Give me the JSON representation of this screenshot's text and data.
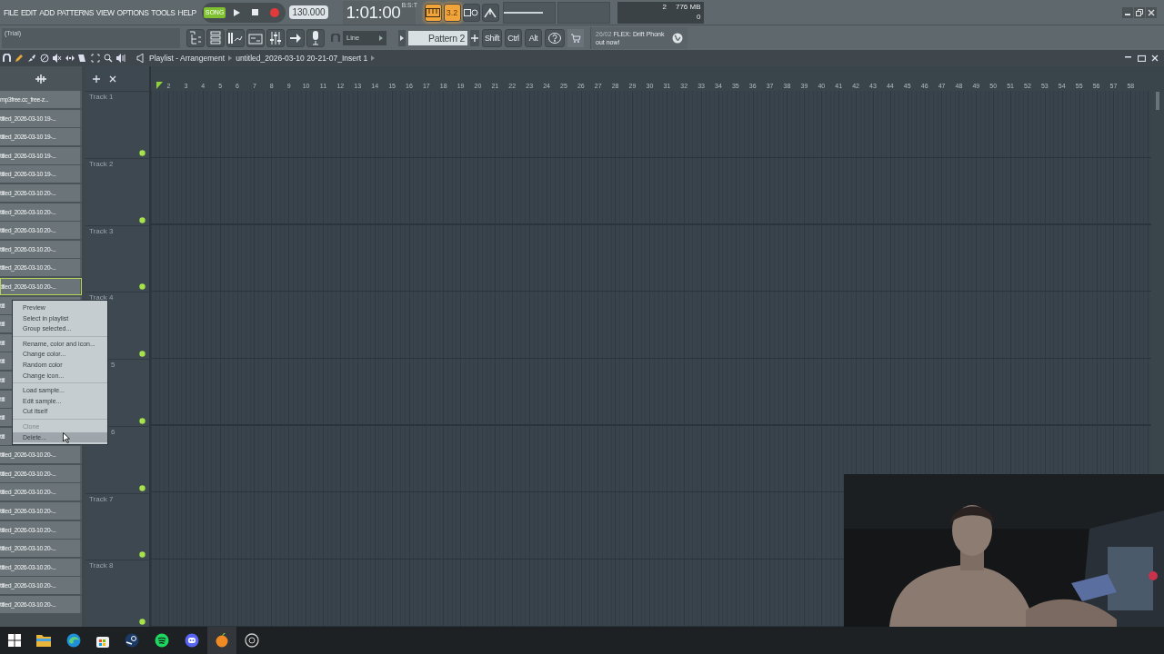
{
  "menu_bar": [
    "FILE",
    "EDIT",
    "ADD",
    "PATTERNS",
    "VIEW",
    "OPTIONS",
    "TOOLS",
    "HELP"
  ],
  "transport": {
    "mode": "SONG",
    "playing": false,
    "recording": true,
    "tempo": "130.000",
    "time": "1:01:00",
    "time_unit": "B:S:T"
  },
  "toggles": [
    {
      "kind": "keyboard",
      "on": true
    },
    {
      "kind": "countdown",
      "label": "3.2",
      "on": true
    },
    {
      "kind": "loop",
      "on": false
    },
    {
      "kind": "metronome",
      "on": false
    }
  ],
  "master_volume": {
    "level": 0.78
  },
  "hint_bar": "(Trial)",
  "snap": "Line",
  "pattern": "Pattern 2",
  "keys": [
    "Shift",
    "Ctrl",
    "Alt"
  ],
  "monitor": {
    "voices": "2",
    "memory": "776 MB",
    "polyphony": "0"
  },
  "news": {
    "date": "26/02",
    "headline": "FLEX: Drift Phonk",
    "subline": "out now!"
  },
  "playlist": {
    "title": "Playlist - Arrangement",
    "breadcrumb": "untitled_2026-03-10 20-21-07_Insert 1"
  },
  "clips": [
    {
      "name": "mp3free.cc_free-z...",
      "selected": false
    },
    {
      "name": "titled_2026-03-10 19-...",
      "selected": false
    },
    {
      "name": "titled_2026-03-10 19-...",
      "selected": false
    },
    {
      "name": "titled_2026-03-10 19-...",
      "selected": false
    },
    {
      "name": "titled_2026-03-10 19-...",
      "selected": false
    },
    {
      "name": "titled_2026-03-10 20-...",
      "selected": false
    },
    {
      "name": "titled_2026-03-10 20-...",
      "selected": false
    },
    {
      "name": "titled_2026-03-10 20-...",
      "selected": false
    },
    {
      "name": "titled_2026-03-10 20-...",
      "selected": false
    },
    {
      "name": "titled_2026-03-10 20-...",
      "selected": false
    },
    {
      "name": "titled_2026-03-10 20-...",
      "selected": true
    },
    {
      "name": "titl",
      "selected": false
    },
    {
      "name": "titl",
      "selected": false
    },
    {
      "name": "titl",
      "selected": false
    },
    {
      "name": "titl",
      "selected": false
    },
    {
      "name": "titl",
      "selected": false
    },
    {
      "name": "titl",
      "selected": false
    },
    {
      "name": "titl",
      "selected": false
    },
    {
      "name": "titl",
      "selected": false
    },
    {
      "name": "titled_2026-03-10 20-...",
      "selected": false
    },
    {
      "name": "titled_2026-03-10 20-...",
      "selected": false
    },
    {
      "name": "titled_2026-03-10 20-...",
      "selected": false
    },
    {
      "name": "titled_2026-03-10 20-...",
      "selected": false
    },
    {
      "name": "titled_2026-03-10 20-...",
      "selected": false
    },
    {
      "name": "titled_2026-03-10 20-...",
      "selected": false
    },
    {
      "name": "titled_2026-03-10 20-...",
      "selected": false
    },
    {
      "name": "titled_2026-03-10 20-...",
      "selected": false
    },
    {
      "name": "titled_2026-03-10 20-...",
      "selected": false
    }
  ],
  "tracks": [
    {
      "name": "Track 1",
      "cut": false
    },
    {
      "name": "Track 2",
      "cut": false
    },
    {
      "name": "Track 3",
      "cut": false
    },
    {
      "name": "Track 4",
      "cut": false
    },
    {
      "name": "5",
      "cut": true
    },
    {
      "name": "6",
      "cut": true
    },
    {
      "name": "Track 7",
      "cut": false
    },
    {
      "name": "Track 8",
      "cut": false
    }
  ],
  "ruler": [
    "2",
    "3",
    "4",
    "5",
    "6",
    "7",
    "8",
    "9",
    "10",
    "11",
    "12",
    "13",
    "14",
    "15",
    "16",
    "17",
    "18",
    "19",
    "20",
    "21",
    "22",
    "23",
    "24",
    "25",
    "26",
    "27",
    "28",
    "29",
    "30",
    "31",
    "32",
    "33",
    "34",
    "35",
    "36",
    "37",
    "38",
    "39",
    "40",
    "41",
    "42",
    "43",
    "44",
    "45",
    "46",
    "47",
    "48",
    "49",
    "50",
    "51",
    "52",
    "53",
    "54",
    "55",
    "56",
    "57",
    "58"
  ],
  "context_menu": {
    "groups": [
      [
        {
          "label": "Preview",
          "disabled": false,
          "selected": false
        },
        {
          "label": "Select in playlist",
          "disabled": false,
          "selected": false
        },
        {
          "label": "Group selected...",
          "disabled": false,
          "selected": false
        }
      ],
      [
        {
          "label": "Rename, color and icon...",
          "disabled": false,
          "selected": false
        },
        {
          "label": "Change color...",
          "disabled": false,
          "selected": false
        },
        {
          "label": "Random color",
          "disabled": false,
          "selected": false
        },
        {
          "label": "Change icon...",
          "disabled": false,
          "selected": false
        }
      ],
      [
        {
          "label": "Load sample...",
          "disabled": false,
          "selected": false
        },
        {
          "label": "Edit sample...",
          "disabled": false,
          "selected": false
        },
        {
          "label": "Cut itself",
          "disabled": false,
          "selected": false
        }
      ],
      [
        {
          "label": "Clone",
          "disabled": true,
          "selected": false
        },
        {
          "label": "Delete...",
          "disabled": false,
          "selected": true
        }
      ]
    ]
  },
  "webcam": {
    "kind": "picture"
  }
}
